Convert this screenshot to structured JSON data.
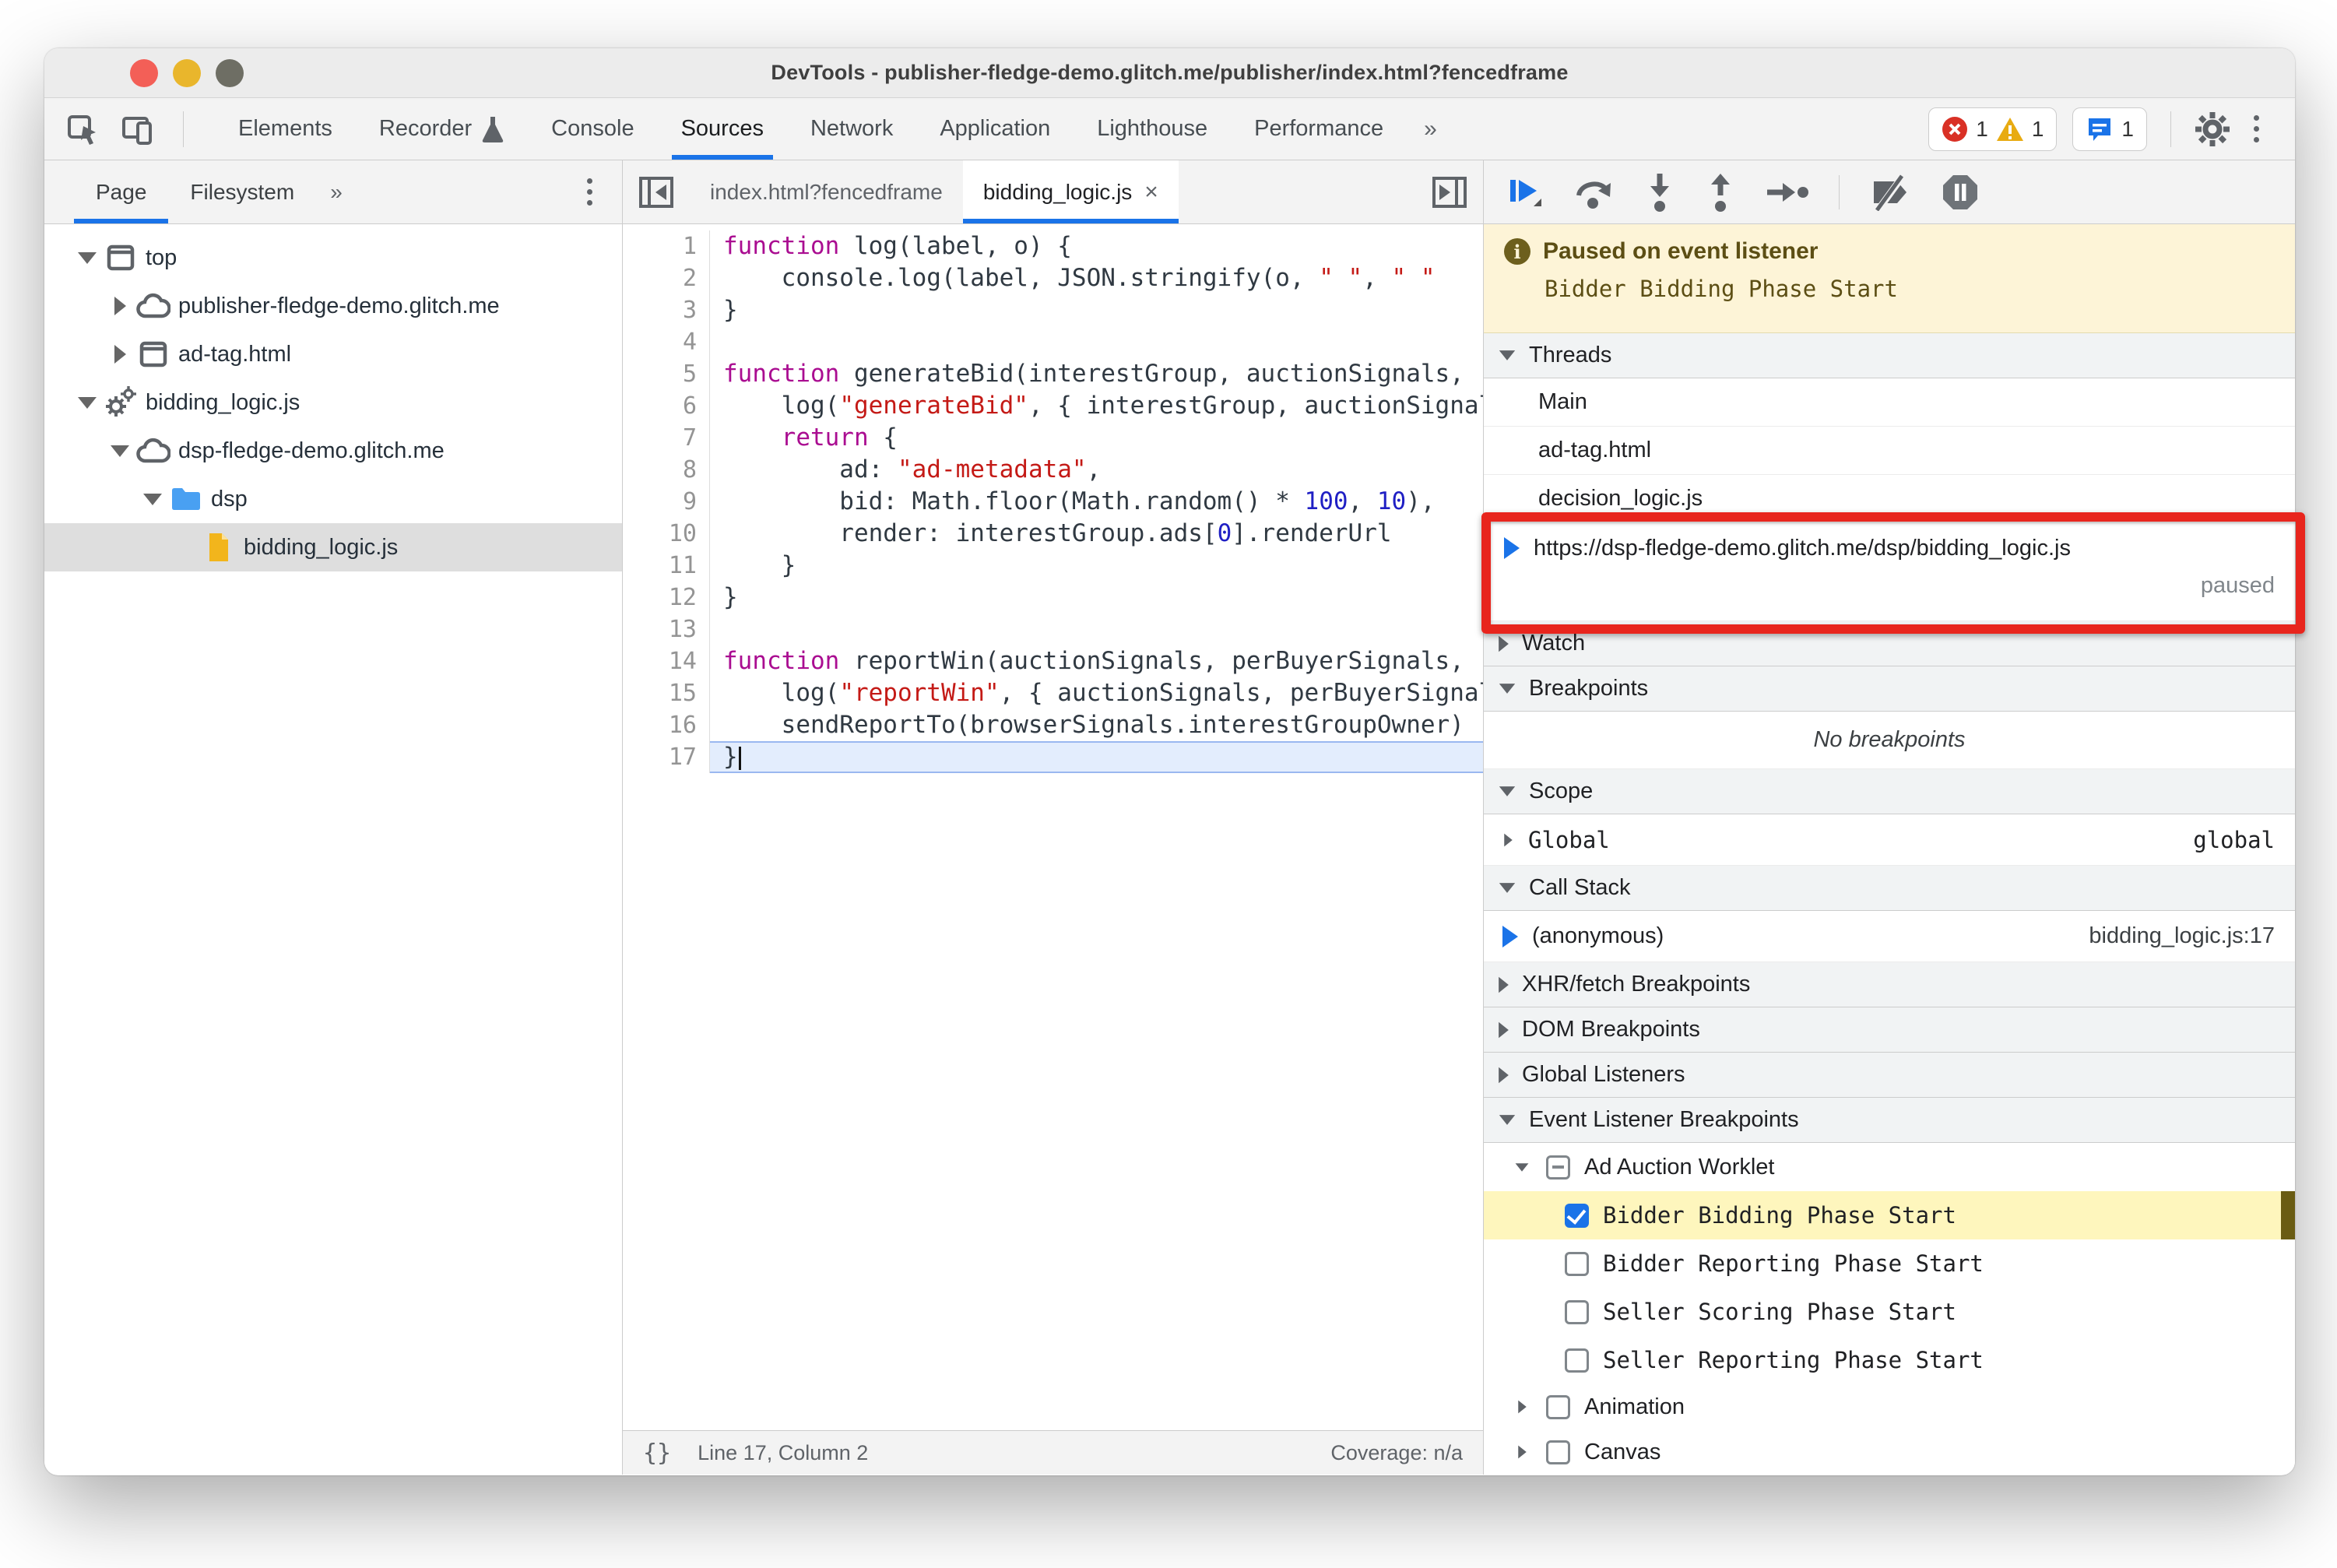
{
  "colors": {
    "accent_blue": "#1a73e8",
    "annotation_red": "#e8251d",
    "paused_banner_bg": "#fdf4d7",
    "paused_text": "#5c4e14",
    "highlight_yellow": "#fef6bd",
    "keyword": "#aa0d91",
    "string": "#c41a16",
    "number": "#1f1fc4"
  },
  "window": {
    "title": "DevTools - publisher-fledge-demo.glitch.me/publisher/index.html?fencedframe"
  },
  "main_tabs": {
    "items": [
      {
        "label": "Elements",
        "active": false,
        "icon": null
      },
      {
        "label": "Recorder",
        "active": false,
        "icon": "flask-icon"
      },
      {
        "label": "Console",
        "active": false,
        "icon": null
      },
      {
        "label": "Sources",
        "active": true,
        "icon": null
      },
      {
        "label": "Network",
        "active": false,
        "icon": null
      },
      {
        "label": "Application",
        "active": false,
        "icon": null
      },
      {
        "label": "Lighthouse",
        "active": false,
        "icon": null
      },
      {
        "label": "Performance",
        "active": false,
        "icon": null
      }
    ],
    "overflow_chevrons": "»",
    "error_count": "1",
    "warning_count": "1",
    "issues_count": "1"
  },
  "sidebar": {
    "tabs": [
      "Page",
      "Filesystem"
    ],
    "active_tab": "Page",
    "overflow_chevrons": "»",
    "tree": [
      {
        "indent": 0,
        "arrow": "down",
        "icon": "frame",
        "label": "top",
        "selected": false
      },
      {
        "indent": 1,
        "arrow": "right",
        "icon": "cloud",
        "label": "publisher-fledge-demo.glitch.me",
        "selected": false
      },
      {
        "indent": 1,
        "arrow": "right",
        "icon": "frame",
        "label": "ad-tag.html",
        "selected": false
      },
      {
        "indent": 0,
        "arrow": "down",
        "icon": "gears",
        "label": "bidding_logic.js",
        "selected": false
      },
      {
        "indent": 1,
        "arrow": "down",
        "icon": "cloud",
        "label": "dsp-fledge-demo.glitch.me",
        "selected": false
      },
      {
        "indent": 2,
        "arrow": "down",
        "icon": "folder",
        "label": "dsp",
        "selected": false
      },
      {
        "indent": 3,
        "arrow": "none",
        "icon": "file",
        "label": "bidding_logic.js",
        "selected": true
      }
    ]
  },
  "editor": {
    "tabs": [
      {
        "label": "index.html?fencedframe",
        "active": false,
        "closable": false
      },
      {
        "label": "bidding_logic.js",
        "active": true,
        "closable": true,
        "close_glyph": "×"
      }
    ],
    "lines": [
      {
        "n": "1",
        "current": false,
        "segments": [
          {
            "t": "function",
            "c": "kw"
          },
          {
            "t": " log(label, o) {",
            "c": "pl"
          }
        ]
      },
      {
        "n": "2",
        "current": false,
        "segments": [
          {
            "t": "    console.log(label, JSON.stringify(o, ",
            "c": "pl"
          },
          {
            "t": "\" \"",
            "c": "str"
          },
          {
            "t": ", ",
            "c": "pl"
          },
          {
            "t": "\" \"",
            "c": "str"
          }
        ]
      },
      {
        "n": "3",
        "current": false,
        "segments": [
          {
            "t": "}",
            "c": "pl"
          }
        ]
      },
      {
        "n": "4",
        "current": false,
        "segments": []
      },
      {
        "n": "5",
        "current": false,
        "segments": [
          {
            "t": "function",
            "c": "kw"
          },
          {
            "t": " generateBid(interestGroup, auctionSignals,",
            "c": "pl"
          }
        ]
      },
      {
        "n": "6",
        "current": false,
        "segments": [
          {
            "t": "    log(",
            "c": "pl"
          },
          {
            "t": "\"generateBid\"",
            "c": "str"
          },
          {
            "t": ", { interestGroup, auctionSignals,",
            "c": "pl"
          }
        ]
      },
      {
        "n": "7",
        "current": false,
        "segments": [
          {
            "t": "    ",
            "c": "pl"
          },
          {
            "t": "return",
            "c": "kw"
          },
          {
            "t": " {",
            "c": "pl"
          }
        ]
      },
      {
        "n": "8",
        "current": false,
        "segments": [
          {
            "t": "        ad: ",
            "c": "pl"
          },
          {
            "t": "\"ad-metadata\"",
            "c": "str"
          },
          {
            "t": ",",
            "c": "pl"
          }
        ]
      },
      {
        "n": "9",
        "current": false,
        "segments": [
          {
            "t": "        bid: Math.floor(Math.random() * ",
            "c": "pl"
          },
          {
            "t": "100",
            "c": "num"
          },
          {
            "t": ", ",
            "c": "pl"
          },
          {
            "t": "10",
            "c": "num"
          },
          {
            "t": "),",
            "c": "pl"
          }
        ]
      },
      {
        "n": "10",
        "current": false,
        "segments": [
          {
            "t": "        render: interestGroup.ads[",
            "c": "pl"
          },
          {
            "t": "0",
            "c": "num"
          },
          {
            "t": "].renderUrl",
            "c": "pl"
          }
        ]
      },
      {
        "n": "11",
        "current": false,
        "segments": [
          {
            "t": "    }",
            "c": "pl"
          }
        ]
      },
      {
        "n": "12",
        "current": false,
        "segments": [
          {
            "t": "}",
            "c": "pl"
          }
        ]
      },
      {
        "n": "13",
        "current": false,
        "segments": []
      },
      {
        "n": "14",
        "current": false,
        "segments": [
          {
            "t": "function",
            "c": "kw"
          },
          {
            "t": " reportWin(auctionSignals, perBuyerSignals,",
            "c": "pl"
          }
        ]
      },
      {
        "n": "15",
        "current": false,
        "segments": [
          {
            "t": "    log(",
            "c": "pl"
          },
          {
            "t": "\"reportWin\"",
            "c": "str"
          },
          {
            "t": ", { auctionSignals, perBuyerSignals,",
            "c": "pl"
          }
        ]
      },
      {
        "n": "16",
        "current": false,
        "segments": [
          {
            "t": "    sendReportTo(browserSignals.interestGroupOwner)",
            "c": "pl"
          }
        ]
      },
      {
        "n": "17",
        "current": true,
        "segments": [
          {
            "t": "}",
            "c": "pl"
          }
        ]
      }
    ],
    "status": {
      "line_col": "Line 17, Column 2",
      "coverage": "Coverage: n/a",
      "braces_glyph": "{}"
    }
  },
  "debugger": {
    "paused_title": "Paused on event listener",
    "paused_detail": "Bidder Bidding Phase Start",
    "threads": {
      "title": "Threads",
      "rows": [
        {
          "label": "Main",
          "paused": false
        },
        {
          "label": "ad-tag.html",
          "paused": false
        },
        {
          "label": "decision_logic.js",
          "paused": false
        },
        {
          "label": "https://dsp-fledge-demo.glitch.me/dsp/bidding_logic.js",
          "paused": true,
          "badge": "paused"
        }
      ]
    },
    "watch": {
      "title": "Watch"
    },
    "breakpoints": {
      "title": "Breakpoints",
      "empty": "No breakpoints"
    },
    "scope": {
      "title": "Scope",
      "rows": [
        {
          "label": "Global",
          "value": "global"
        }
      ]
    },
    "call_stack": {
      "title": "Call Stack",
      "rows": [
        {
          "label": "(anonymous)",
          "location": "bidding_logic.js:17"
        }
      ]
    },
    "xhr_breakpoints": {
      "title": "XHR/fetch Breakpoints"
    },
    "dom_breakpoints": {
      "title": "DOM Breakpoints"
    },
    "global_listeners": {
      "title": "Global Listeners"
    },
    "event_listener_breakpoints": {
      "title": "Event Listener Breakpoints",
      "groups": [
        {
          "label": "Ad Auction Worklet",
          "arrow": "down",
          "checkbox": "indeterminate",
          "children": [
            {
              "label": "Bidder Bidding Phase Start",
              "checked": true,
              "highlighted": true
            },
            {
              "label": "Bidder Reporting Phase Start",
              "checked": false,
              "highlighted": false
            },
            {
              "label": "Seller Scoring Phase Start",
              "checked": false,
              "highlighted": false
            },
            {
              "label": "Seller Reporting Phase Start",
              "checked": false,
              "highlighted": false
            }
          ]
        },
        {
          "label": "Animation",
          "arrow": "right",
          "checkbox": "unchecked",
          "children": []
        },
        {
          "label": "Canvas",
          "arrow": "right",
          "checkbox": "unchecked",
          "children": []
        }
      ]
    }
  }
}
